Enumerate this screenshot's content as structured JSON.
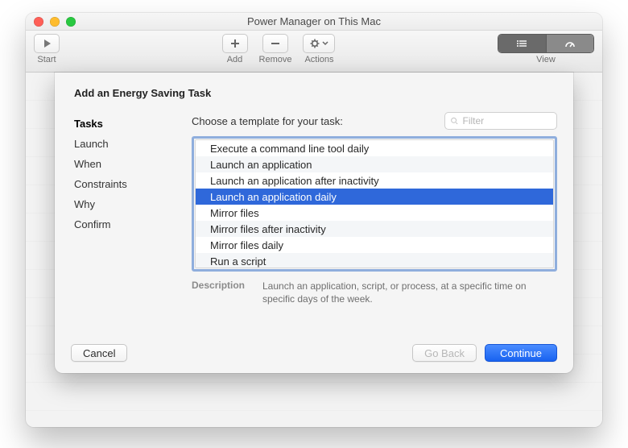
{
  "window": {
    "title": "Power Manager on This Mac"
  },
  "toolbar": {
    "start": "Start",
    "add": "Add",
    "remove": "Remove",
    "actions": "Actions",
    "view": "View"
  },
  "sheet": {
    "heading": "Add an Energy Saving Task",
    "sidebar": {
      "steps": [
        "Tasks",
        "Launch",
        "When",
        "Constraints",
        "Why",
        "Confirm"
      ],
      "active_index": 0
    },
    "prompt": "Choose a template for your task:",
    "filter": {
      "placeholder": "Filter",
      "value": ""
    },
    "templates": [
      "Execute a command line tool daily",
      "Launch an application",
      "Launch an application after inactivity",
      "Launch an application daily",
      "Mirror files",
      "Mirror files after inactivity",
      "Mirror files daily",
      "Run a script"
    ],
    "selected_index": 3,
    "description": {
      "label": "Description",
      "text": "Launch an application, script, or process, at a specific time on specific days of the week."
    },
    "buttons": {
      "cancel": "Cancel",
      "go_back": "Go Back",
      "continue": "Continue"
    }
  }
}
